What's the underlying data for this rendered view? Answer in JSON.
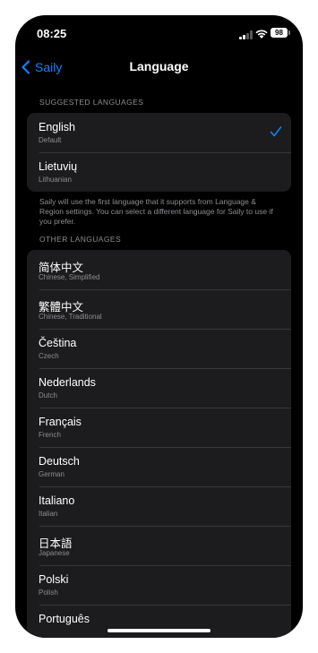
{
  "status_bar": {
    "time": "08:25",
    "battery": "98"
  },
  "nav": {
    "back_label": "Saily",
    "title": "Language"
  },
  "suggested": {
    "header": "SUGGESTED LANGUAGES",
    "items": [
      {
        "name": "English",
        "sub": "Default",
        "selected": true
      },
      {
        "name": "Lietuvių",
        "sub": "Lithuanian",
        "selected": false
      }
    ],
    "footer": "Saily will use the first language that it supports from Language & Region settings. You can select a different language for Saily to use if you prefer."
  },
  "other": {
    "header": "OTHER LANGUAGES",
    "items": [
      {
        "name": "简体中文",
        "sub": "Chinese, Simplified"
      },
      {
        "name": "繁體中文",
        "sub": "Chinese, Traditional"
      },
      {
        "name": "Čeština",
        "sub": "Czech"
      },
      {
        "name": "Nederlands",
        "sub": "Dutch"
      },
      {
        "name": "Français",
        "sub": "French"
      },
      {
        "name": "Deutsch",
        "sub": "German"
      },
      {
        "name": "Italiano",
        "sub": "Italian"
      },
      {
        "name": "日本語",
        "sub": "Japanese"
      },
      {
        "name": "Polski",
        "sub": "Polish"
      },
      {
        "name": "Português",
        "sub": ""
      }
    ]
  },
  "colors": {
    "accent": "#0a84ff",
    "background": "#000000",
    "cell": "#1c1c1e",
    "secondary_text": "#8e8e93"
  }
}
